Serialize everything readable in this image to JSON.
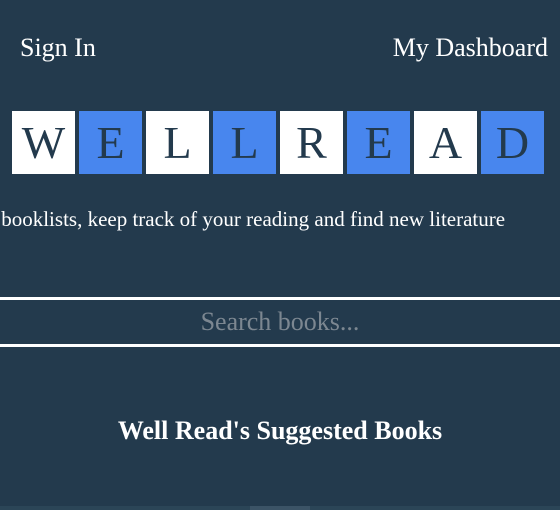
{
  "nav": {
    "sign_in": "Sign In",
    "dashboard": "My Dashboard"
  },
  "logo": {
    "tiles": [
      {
        "letter": "W",
        "style": "white"
      },
      {
        "letter": "E",
        "style": "blue"
      },
      {
        "letter": "L",
        "style": "white"
      },
      {
        "letter": "L",
        "style": "blue"
      },
      {
        "letter": "R",
        "style": "white"
      },
      {
        "letter": "E",
        "style": "blue"
      },
      {
        "letter": "A",
        "style": "white"
      },
      {
        "letter": "D",
        "style": "blue"
      }
    ],
    "colors": {
      "white": "#ffffff",
      "blue": "#4886ee",
      "text": "#233a4d"
    }
  },
  "tagline": "Curate booklists, keep track of your reading and find new literature",
  "search": {
    "placeholder": "Search books...",
    "value": ""
  },
  "suggested": {
    "title": "Well Read's Suggested Books"
  },
  "theme": {
    "background": "#233a4d",
    "accent": "#4886ee"
  }
}
